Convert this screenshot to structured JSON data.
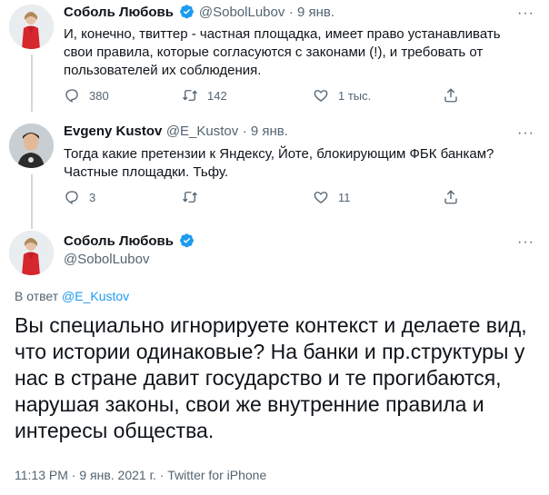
{
  "tweets": [
    {
      "name": "Соболь Любовь",
      "handle": "@SobolLubov",
      "time": "· 9 янв.",
      "text_lines": [
        "И, конечно, твиттер - частная площадка, имеет право устанавливать",
        "свои правила, которые согласуются с законами (!), и требовать от",
        "пользователей их соблюдения."
      ],
      "replies": "380",
      "retweets": "142",
      "likes": "1 тыс."
    },
    {
      "name": "Evgeny Kustov",
      "handle": "@E_Kustov",
      "time": "· 9 янв.",
      "text_lines": [
        "Тогда какие претензии к Яндексу, Йоте, блокирующим ФБК банкам?",
        "Частные площадки. Тьфу."
      ],
      "replies": "3",
      "retweets": "",
      "likes": "11"
    }
  ],
  "main_tweet": {
    "name": "Соболь Любовь",
    "handle": "@SobolLubov",
    "reply_prefix": "В ответ",
    "reply_to": "@E_Kustov",
    "text_lines": [
      "Вы специально игнорируете контекст и делаете вид,",
      "что истории одинаковые? На банки и пр.структуры у",
      "нас в стране давит государство и те прогибаются,",
      "нарушая законы, свои же внутренние правила и",
      "интересы общества."
    ],
    "timestamp": "11:13 PM · 9 янв. 2021 г. ·",
    "source": "Twitter for iPhone"
  },
  "icons": {
    "reply": "reply-icon",
    "retweet": "retweet-icon",
    "like": "heart-icon",
    "share": "share-icon",
    "verified": "verified-badge-icon",
    "more": "more-icon"
  },
  "colors": {
    "accent": "#1d9bf0",
    "text": "#0f1419",
    "secondary": "#536471",
    "divider": "#eff3f4"
  }
}
